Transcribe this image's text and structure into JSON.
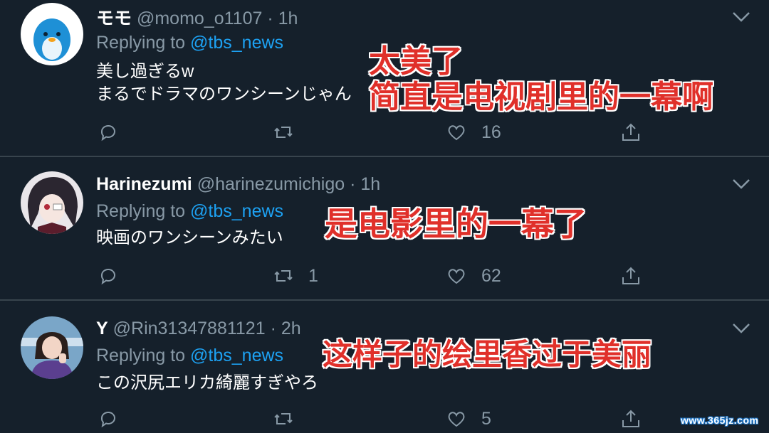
{
  "colors": {
    "background": "#15202b",
    "muted": "#8899a6",
    "link": "#1da1f2",
    "overlay_red": "#e0302a"
  },
  "tweets": [
    {
      "name": "モモ",
      "handle": "@momo_o1107",
      "time": "1h",
      "replying_prefix": "Replying to ",
      "replying_to": "@tbs_news",
      "text_lines": [
        "美し過ぎるw",
        "まるでドラマのワンシーンじゃん"
      ],
      "retweets": "",
      "likes": "16",
      "icons": {
        "reply": "reply-icon",
        "retweet": "retweet-icon",
        "like": "heart-icon",
        "share": "share-icon",
        "menu": "chevron-down-icon"
      }
    },
    {
      "name": "Harinezumi",
      "handle": "@harinezumichigo",
      "time": "1h",
      "replying_prefix": "Replying to ",
      "replying_to": "@tbs_news",
      "text_lines": [
        "映画のワンシーンみたい"
      ],
      "retweets": "1",
      "likes": "62"
    },
    {
      "name": "Y",
      "handle": "@Rin31347881121",
      "time": "2h",
      "replying_prefix": "Replying to ",
      "replying_to": "@tbs_news",
      "text_lines": [
        "この沢尻エリカ綺麗すぎやろ"
      ],
      "retweets": "",
      "likes": "5"
    }
  ],
  "overlays": [
    {
      "lines": [
        "太美了",
        "简直是电视剧里的一幕啊"
      ]
    },
    {
      "lines": [
        "是电影里的一幕了"
      ]
    },
    {
      "lines": [
        "这样子的绘里香过于美丽"
      ]
    }
  ],
  "watermark": "www.365jz.com",
  "separator": " · "
}
